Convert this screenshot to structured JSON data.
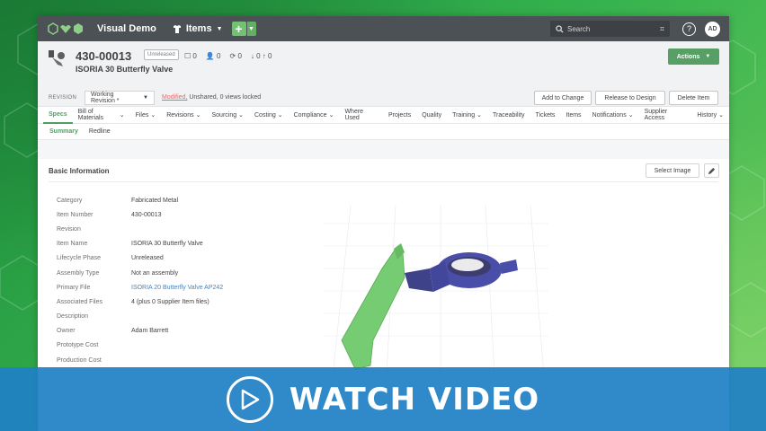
{
  "topnav": {
    "app_name": "Visual Demo",
    "items_menu": "Items",
    "search_placeholder": "Search",
    "help": "?",
    "avatar": "AD"
  },
  "header": {
    "item_number": "430-00013",
    "status_badge": "Unreleased",
    "counts": [
      "0",
      "0",
      "0",
      "0",
      "0"
    ],
    "item_name": "ISORIA 30 Butterfly Valve",
    "actions_label": "Actions",
    "revision_label": "REVISION",
    "revision_value": "Working Revision *",
    "modified_label": "Modified,",
    "modified_rest": " Unshared, 0 views locked",
    "buttons": {
      "add_to_change": "Add to Change",
      "release_to_design": "Release to Design",
      "delete_item": "Delete Item"
    }
  },
  "tabs": [
    {
      "label": "Specs",
      "caret": false
    },
    {
      "label": "Bill of Materials",
      "caret": true
    },
    {
      "label": "Files",
      "caret": true
    },
    {
      "label": "Revisions",
      "caret": true
    },
    {
      "label": "Sourcing",
      "caret": true
    },
    {
      "label": "Costing",
      "caret": true
    },
    {
      "label": "Compliance",
      "caret": true
    },
    {
      "label": "Where Used",
      "caret": false
    },
    {
      "label": "Projects",
      "caret": false
    },
    {
      "label": "Quality",
      "caret": false
    },
    {
      "label": "Training",
      "caret": true
    },
    {
      "label": "Traceability",
      "caret": false
    },
    {
      "label": "Tickets",
      "caret": false
    },
    {
      "label": "Items",
      "caret": false
    },
    {
      "label": "Notifications",
      "caret": true
    },
    {
      "label": "Supplier Access",
      "caret": false
    },
    {
      "label": "History",
      "caret": true
    }
  ],
  "subtabs": {
    "summary": "Summary",
    "redline": "Redline"
  },
  "basic_info": {
    "title": "Basic Information",
    "select_image": "Select Image",
    "fields": [
      {
        "label": "Category",
        "value": "Fabricated Metal"
      },
      {
        "label": "Item Number",
        "value": "430-00013"
      },
      {
        "label": "Revision",
        "value": ""
      },
      {
        "label": "Item Name",
        "value": "ISORIA 30 Butterfly Valve"
      },
      {
        "label": "Lifecycle Phase",
        "value": "Unreleased"
      },
      {
        "label": "Assembly Type",
        "value": "Not an assembly"
      },
      {
        "label": "Primary File",
        "value": "ISORIA 20 Butterfly Valve AP242"
      },
      {
        "label": "Associated Files",
        "value": "4 (plus 0 Supplier Item files)"
      },
      {
        "label": "Description",
        "value": ""
      },
      {
        "label": "Owner",
        "value": "Adam Barrett"
      },
      {
        "label": "Prototype Cost",
        "value": ""
      },
      {
        "label": "Production Cost",
        "value": ""
      }
    ]
  },
  "video": {
    "label": "WATCH VIDEO"
  },
  "colors": {
    "accent_green": "#2f8f48",
    "nav_dark": "#2d3339",
    "video_blue": "#2080c4",
    "link_blue": "#2a6db3",
    "modified_red": "#d9534f"
  },
  "icons": [
    "logo-icon",
    "shirt-icon",
    "plus-icon",
    "search-icon",
    "help-icon",
    "valve-icon",
    "play-icon",
    "pencil-icon"
  ]
}
